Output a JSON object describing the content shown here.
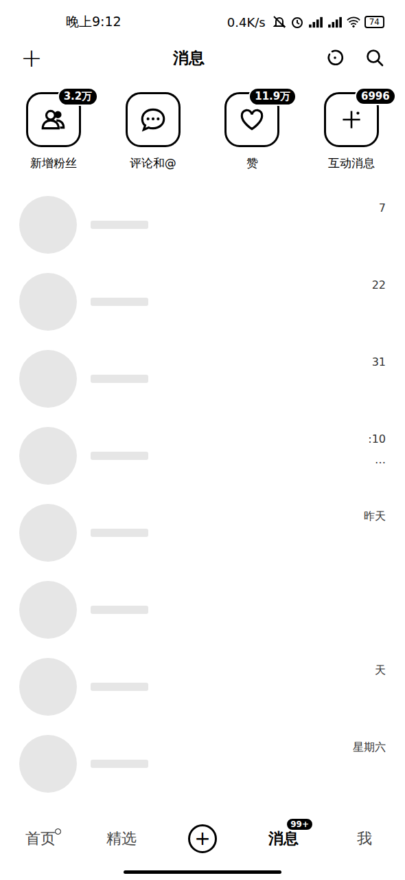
{
  "status_bar": {
    "time": "晚上9:12",
    "speed": "0.4K/s",
    "battery": "74"
  },
  "header": {
    "add": "+",
    "title": "消息"
  },
  "shortcuts": [
    {
      "label": "新增粉丝",
      "badge": "3.2万",
      "kind": "fans"
    },
    {
      "label": "评论和@",
      "kind": "comment"
    },
    {
      "label": "赞",
      "badge": "11.9万",
      "kind": "like"
    },
    {
      "label": "互动消息",
      "badge": "6996",
      "kind": "interact"
    }
  ],
  "conversations": [
    {
      "time": "7"
    },
    {
      "time": "22"
    },
    {
      "time": "31"
    },
    {
      "time": ":10",
      "preview": "…"
    },
    {
      "time": "昨天"
    },
    {
      "time": ""
    },
    {
      "time": "天"
    },
    {
      "time": "星期六"
    }
  ],
  "tabs": [
    {
      "label": "首页",
      "selected": false,
      "dot": true,
      "kind": "tab"
    },
    {
      "label": "精选",
      "selected": false,
      "kind": "tab"
    },
    {
      "label": "+",
      "selected": false,
      "kind": "create"
    },
    {
      "label": "消息",
      "selected": true,
      "badge": "99+",
      "kind": "tab"
    },
    {
      "label": "我",
      "selected": false,
      "kind": "tab"
    }
  ]
}
